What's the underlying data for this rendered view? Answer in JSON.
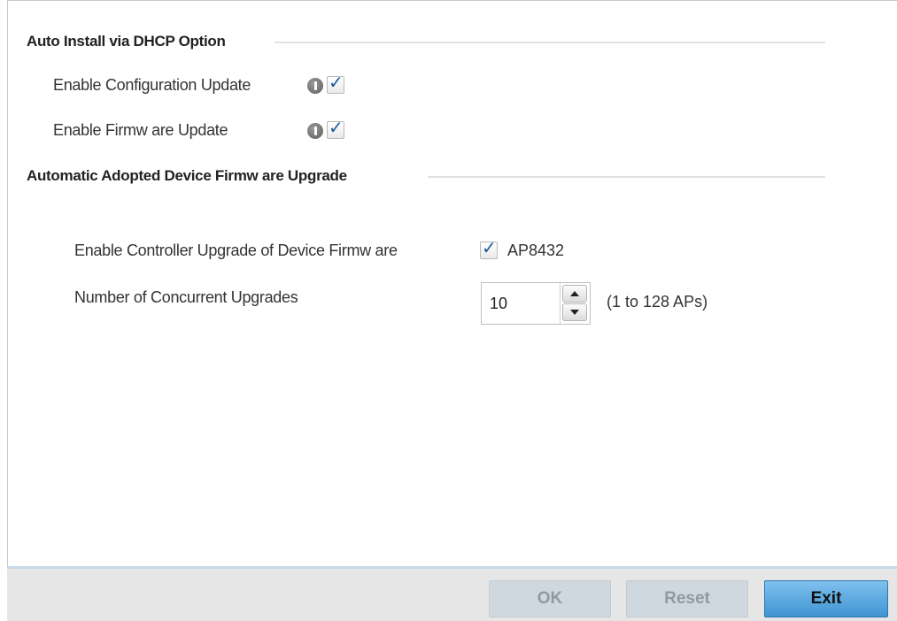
{
  "sections": {
    "auto_install": {
      "title": "Auto Install via DHCP Option",
      "config_update_label": "Enable Configuration Update",
      "config_update_checked": true,
      "firmware_update_label": "Enable Firmw are Update",
      "firmware_update_checked": true
    },
    "firmware_upgrade": {
      "title": "Automatic Adopted Device Firmw are Upgrade",
      "controller_upgrade_label": "Enable Controller Upgrade of Device Firmw are",
      "controller_upgrade_checked": true,
      "device_model": "AP8432",
      "concurrent_label": "Number of Concurrent Upgrades",
      "concurrent_value": "10",
      "concurrent_range": "(1 to 128 APs)"
    }
  },
  "check_glyph": "✓",
  "buttons": {
    "ok": "OK",
    "reset": "Reset",
    "exit": "Exit"
  },
  "colors": {
    "accent": "#3f94d2",
    "disabled_button": "#cfd8de",
    "checkmark": "#1f5a98"
  }
}
